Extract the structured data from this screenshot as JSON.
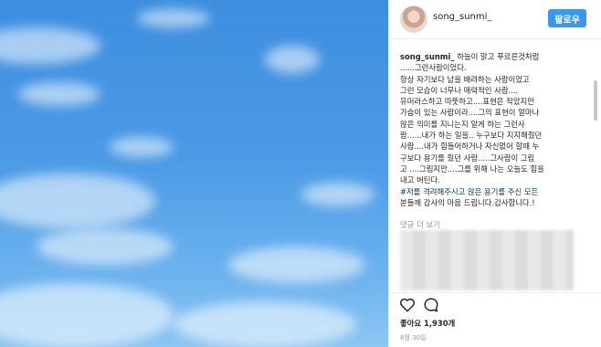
{
  "header": {
    "username": "song_sunmi_",
    "follow_label": "팔로우"
  },
  "caption": {
    "username": "song_sunmi_",
    "lines": [
      " 하늘이 맑고 푸르른것처럼",
      "......그런사람이었다.",
      "항상 자기보다 남을 배려하는 사람이었고",
      "그런 모습이 너무나 매력적인 사람....",
      "유머러스하고 따뜻하고....표현은 작았지만",
      "가슴이 있는 사람이라....그의 표현이 얼마나",
      "많은 의미를 지니는지 알게 하는 그런사",
      "람......내가 하는 일을.. 누구보다 지지해줬던",
      "사람....내가 힘들어하거나 자신없어 할때 누",
      "구보다 용기를 줬던 사람.....그사람이 그립",
      "고 ....그립지만....그를 위해 나는 오늘도 힘을",
      "내고 버틴다."
    ],
    "tag_lines": [
      "#저를 격려해주시고 많은 용기를 주신 모든",
      "분들께 감사의 마음 드립니다.감사합니다.!"
    ]
  },
  "comments": {
    "more_label": "댓글 더 보기"
  },
  "actions": {
    "like_icon": "heart-icon",
    "comment_icon": "comment-icon"
  },
  "likes": "좋아요 1,930개",
  "date": "8월 30일"
}
